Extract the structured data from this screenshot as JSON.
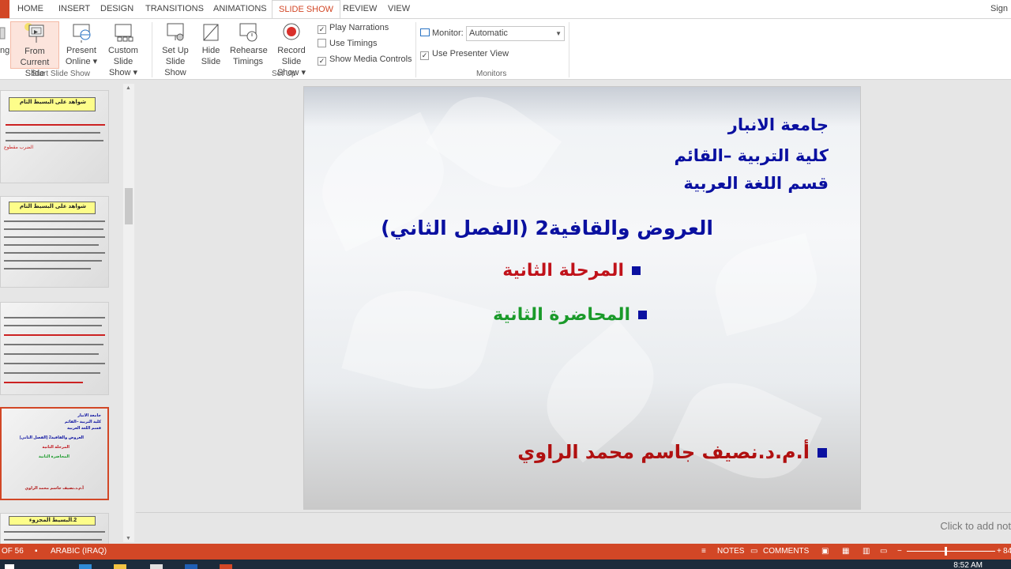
{
  "tabs": [
    "HOME",
    "INSERT",
    "DESIGN",
    "TRANSITIONS",
    "ANIMATIONS",
    "SLIDE SHOW",
    "REVIEW",
    "VIEW"
  ],
  "active_tab": "SLIDE SHOW",
  "signin": "Sign",
  "ribbon": {
    "from_beginning_fragment": "ng",
    "from_current_line1": "From",
    "from_current_line2": "Current Slide",
    "present_online_line1": "Present",
    "present_online_line2": "Online ▾",
    "custom_show_line1": "Custom Slide",
    "custom_show_line2": "Show ▾",
    "group_start": "Start Slide Show",
    "setup_line1": "Set Up",
    "setup_line2": "Slide Show",
    "hide_line1": "Hide",
    "hide_line2": "Slide",
    "rehearse_line1": "Rehearse",
    "rehearse_line2": "Timings",
    "record_line1": "Record Slide",
    "record_line2": "Show ▾",
    "play_narrations": "Play Narrations",
    "use_timings": "Use Timings",
    "show_media_controls": "Show Media Controls",
    "group_setup": "Set Up",
    "monitor_label": "Monitor:",
    "monitor_value": "Automatic",
    "use_presenter_view": "Use Presenter View",
    "group_monitors": "Monitors"
  },
  "checkboxes": {
    "play_narrations": true,
    "use_timings": false,
    "show_media_controls": true,
    "use_presenter_view": true
  },
  "thumbnails": [
    {
      "title": "شواهد على البسيط التام",
      "subtitle": "الضرب مقطوع"
    },
    {
      "title": "شواهد على البسيط التام"
    },
    {},
    {
      "line1": "جامعة الانبار",
      "line2": "كلية التربية –القائم",
      "line3": "قسم اللغة العربية",
      "line4": "العروض والقافية2 (الفصل الثاني)",
      "line5": "المرحلة الثانية",
      "line6": "المحاضرة الثانية",
      "line7": "أ.م.د.نصيف جاسم محمد الراوي"
    },
    {
      "title": "2.البسيط المجزوء"
    }
  ],
  "slide": {
    "line1": "جامعة الانبار",
    "line2": "كلية التربية –القائم",
    "line3": "قسم اللغة العربية",
    "line4": "العروض والقافية2 (الفصل الثاني)",
    "line5": "المرحلة الثانية",
    "line6": "المحاضرة الثانية",
    "line7": "أ.م.د.نصيف جاسم محمد الراوي"
  },
  "colors": {
    "accent": "#d24726",
    "slide_blue": "#0a10a0",
    "slide_red": "#c0121a",
    "slide_green": "#1a9a2a",
    "author_red": "#b01010"
  },
  "notes_placeholder": "Click to add not",
  "status": {
    "slide_counter": "OF 56",
    "language": "ARABIC (IRAQ)",
    "notes": "NOTES",
    "comments": "COMMENTS",
    "zoom": "84"
  },
  "taskbar": {
    "time": "8:52 AM"
  }
}
